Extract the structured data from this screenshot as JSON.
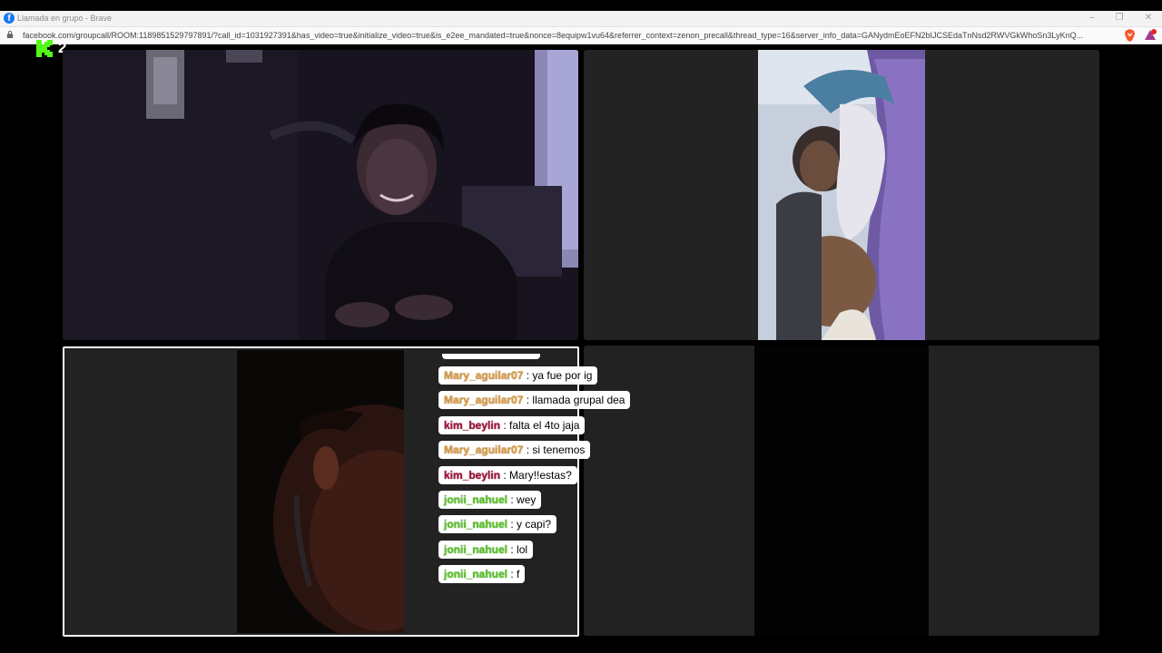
{
  "window": {
    "title": "Llamada en grupo - Brave",
    "url": "facebook.com/groupcall/ROOM:1189851529797891/?call_id=1031927391&has_video=true&initialize_video=true&is_e2ee_mandated=true&nonce=8equipw1vu64&referrer_context=zenon_precall&thread_type=16&server_info_data=GANydmEoEFN2bIJCSEdaTnNsd2RWVGkWhoSn3LyKnQ...",
    "controls": {
      "minimize": "‒",
      "restore": "❐",
      "close": "✕"
    }
  },
  "overlay": {
    "viewer_count": "2",
    "logo_color": "#53fc18"
  },
  "chat": {
    "separator": " : ",
    "messages": [
      {
        "user": "Mary_aguilar07",
        "text": "ya fue por ig"
      },
      {
        "user": "Mary_aguilar07",
        "text": "llamada grupal dea"
      },
      {
        "user": "kim_beylin",
        "text": "falta el 4to jaja"
      },
      {
        "user": "Mary_aguilar07",
        "text": "si tenemos"
      },
      {
        "user": "kim_beylin",
        "text": "Mary!!estas?"
      },
      {
        "user": "jonii_nahuel",
        "text": "wey"
      },
      {
        "user": "jonii_nahuel",
        "text": "y capi?"
      },
      {
        "user": "jonii_nahuel",
        "text": "lol"
      },
      {
        "user": "jonii_nahuel",
        "text": "f"
      }
    ]
  },
  "colors": {
    "mary": "#dfa048",
    "kim": "#a3123a",
    "jonii": "#58c925",
    "tile_bg": "#222222",
    "active_border": "#ffffff"
  }
}
